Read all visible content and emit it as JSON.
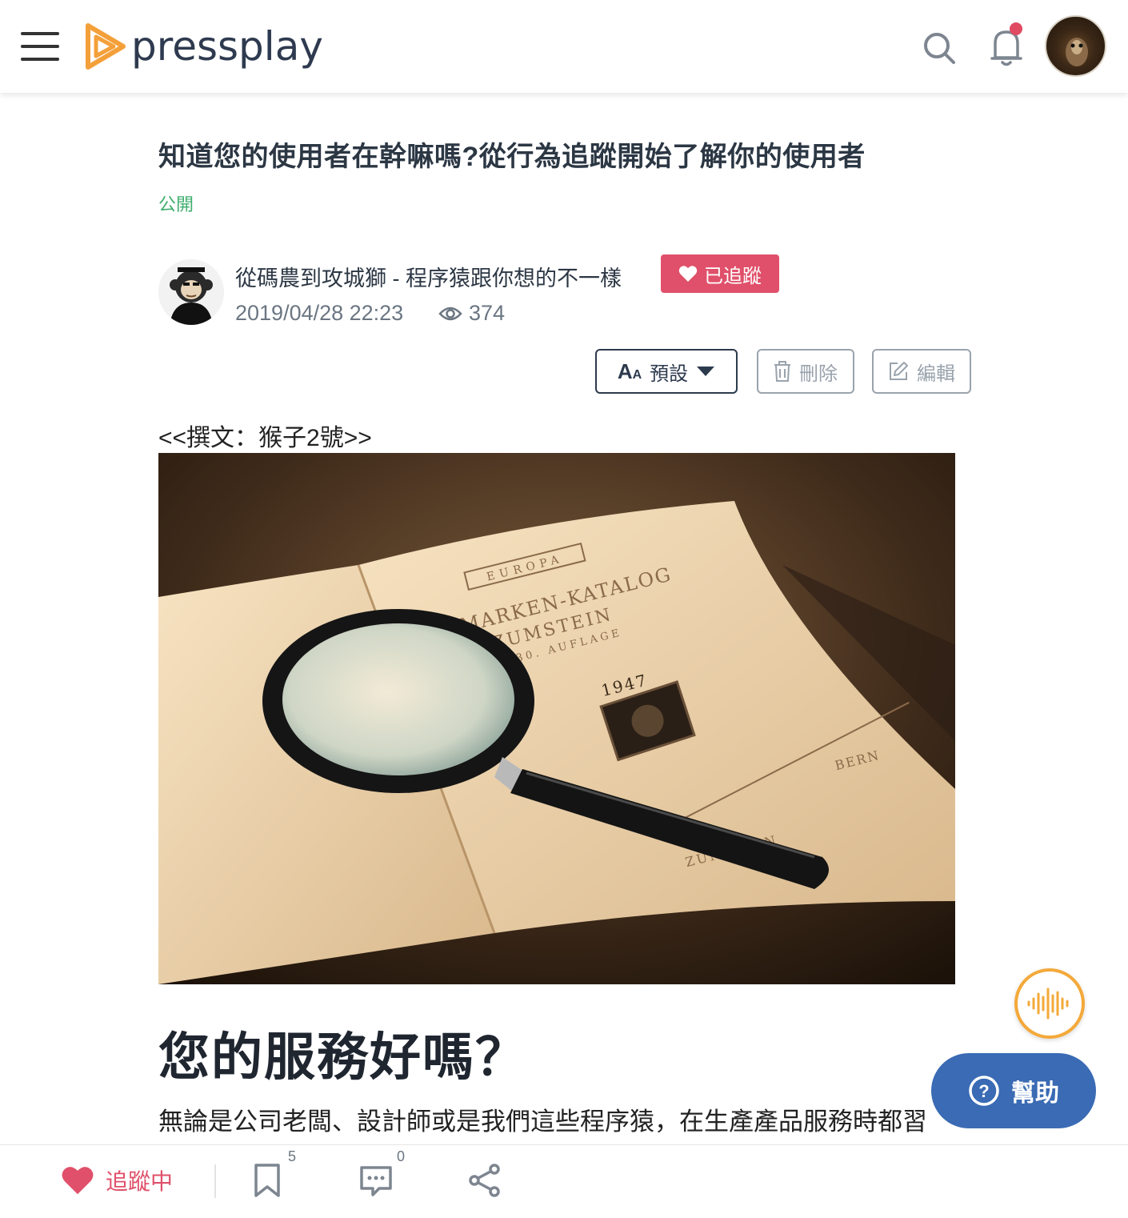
{
  "header": {
    "logo_text": "pressplay",
    "brand_color": "#f4a03a",
    "notification_dot_color": "#e04b62"
  },
  "article": {
    "title": "知道您的使用者在幹嘛嗎?從行為追蹤開始了解你的使用者",
    "visibility": "公開",
    "author_name": "從碼農到攻城獅 - 程序猿跟你想的不一樣",
    "follow_label": "已追蹤",
    "date": "2019/04/28 22:23",
    "views": "374",
    "byline": "<<撰文：猴子2號>>",
    "heading": "您的服務好嗎？",
    "paragraph": "無論是公司老闆、設計師或是我們這些程序猿，在生產產品服務時都習"
  },
  "toolbar": {
    "font_label": "預設",
    "delete_label": "刪除",
    "edit_label": "編輯"
  },
  "hero_image": {
    "book_header": "EUROPA",
    "book_title_1": "BRIEFMARKEN-KATALOG",
    "book_title_2": "ZUMSTEIN",
    "book_edition": "30. AUFLAGE",
    "book_year": "1947",
    "book_footer": "ZUMSTEIN",
    "book_footer_2": "BERN"
  },
  "floating": {
    "help_label": "幫助"
  },
  "bottom_bar": {
    "follow_label": "追蹤中",
    "bookmark_count": "5",
    "comment_count": "0"
  }
}
